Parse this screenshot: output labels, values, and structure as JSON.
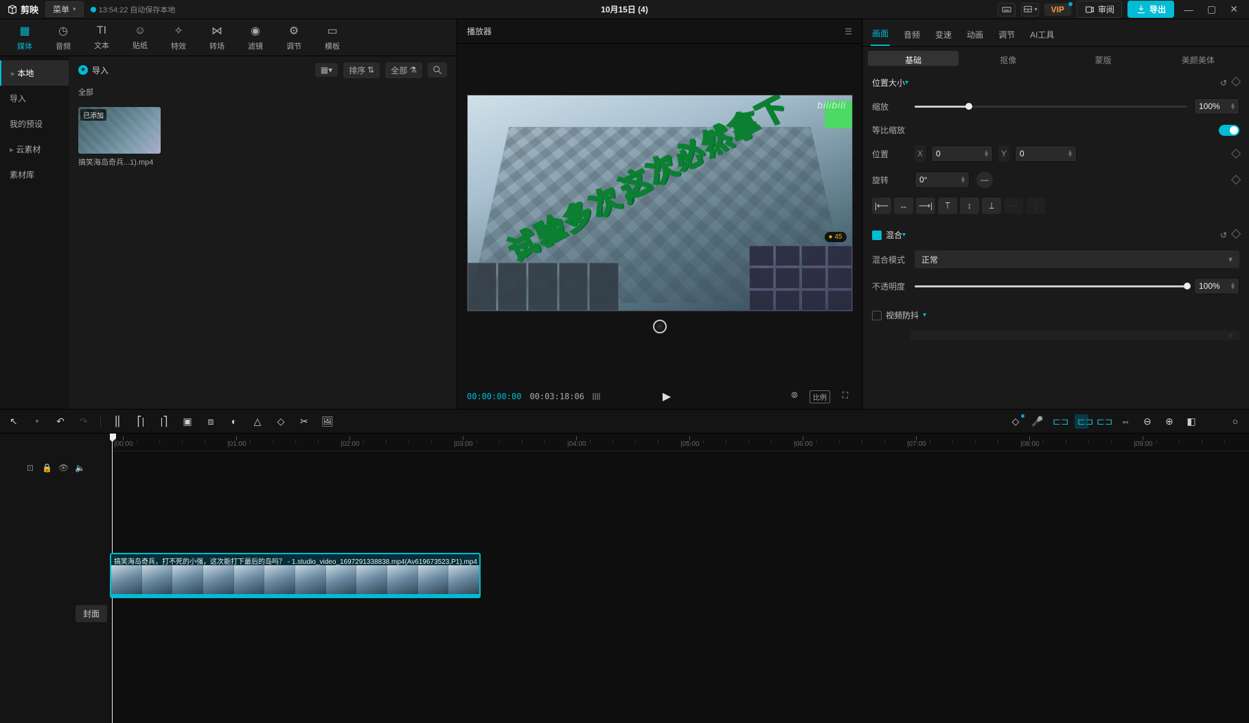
{
  "topbar": {
    "app": "剪映",
    "menu": "菜单",
    "autosave": "13:54:22 自动保存本地",
    "title": "10月15日 (4)",
    "vip": "VIP",
    "review": "审阅",
    "export": "导出"
  },
  "toolTabs": [
    {
      "label": "媒体",
      "active": true
    },
    {
      "label": "音频"
    },
    {
      "label": "文本"
    },
    {
      "label": "贴纸"
    },
    {
      "label": "特效"
    },
    {
      "label": "转场"
    },
    {
      "label": "滤镜"
    },
    {
      "label": "调节"
    },
    {
      "label": "模板"
    }
  ],
  "sideNav": [
    {
      "label": "本地",
      "active": true,
      "arrow": true
    },
    {
      "label": "导入"
    },
    {
      "label": "我的预设"
    },
    {
      "label": "云素材",
      "arrow": true
    },
    {
      "label": "素材库"
    }
  ],
  "mediaBar": {
    "import": "导入",
    "sort": "排序",
    "all": "全部",
    "category": "全部"
  },
  "mediaItems": [
    {
      "name": "搞笑海岛奇兵...1).mp4",
      "badge": "已添加"
    }
  ],
  "preview": {
    "title": "播放器",
    "overlay1": "试验多次，",
    "overlay2": "这次必然拿下",
    "watermark": "bilibili",
    "badge": "45",
    "timeCurrent": "00:00:00:00",
    "timeDuration": "00:03:18:06",
    "ratio": "比例"
  },
  "inspector": {
    "mainTabs": [
      {
        "label": "画面",
        "active": true
      },
      {
        "label": "音频"
      },
      {
        "label": "变速"
      },
      {
        "label": "动画"
      },
      {
        "label": "调节"
      },
      {
        "label": "AI工具"
      }
    ],
    "subTabs": [
      {
        "label": "基础",
        "active": true
      },
      {
        "label": "抠像"
      },
      {
        "label": "蒙版"
      },
      {
        "label": "美颜美体"
      }
    ],
    "secPosSize": "位置大小",
    "scale": {
      "label": "缩放",
      "value": "100%",
      "pct": 20
    },
    "uniform": {
      "label": "等比缩放",
      "on": true
    },
    "position": {
      "label": "位置",
      "x": "0",
      "y": "0"
    },
    "rotation": {
      "label": "旋转",
      "value": "0°"
    },
    "secBlend": "混合",
    "blendMode": {
      "label": "混合模式",
      "value": "正常"
    },
    "opacity": {
      "label": "不透明度",
      "value": "100%",
      "pct": 100
    },
    "stabilize": {
      "label": "视频防抖"
    }
  },
  "timelineTools": {
    "cover": "封面"
  },
  "ruler": [
    "00:00",
    "01:00",
    "02:00",
    "03:00",
    "04:00",
    "05:00",
    "06:00",
    "07:00",
    "08:00",
    "09:00"
  ],
  "clip": {
    "label": "搞笑海岛奇兵，打不死的小强，这次能打下最后的岛吗？ - 1.studio_video_1697291338838.mp4(Av619673523,P1).mp4",
    "startPx": 0,
    "widthPx": 540
  }
}
